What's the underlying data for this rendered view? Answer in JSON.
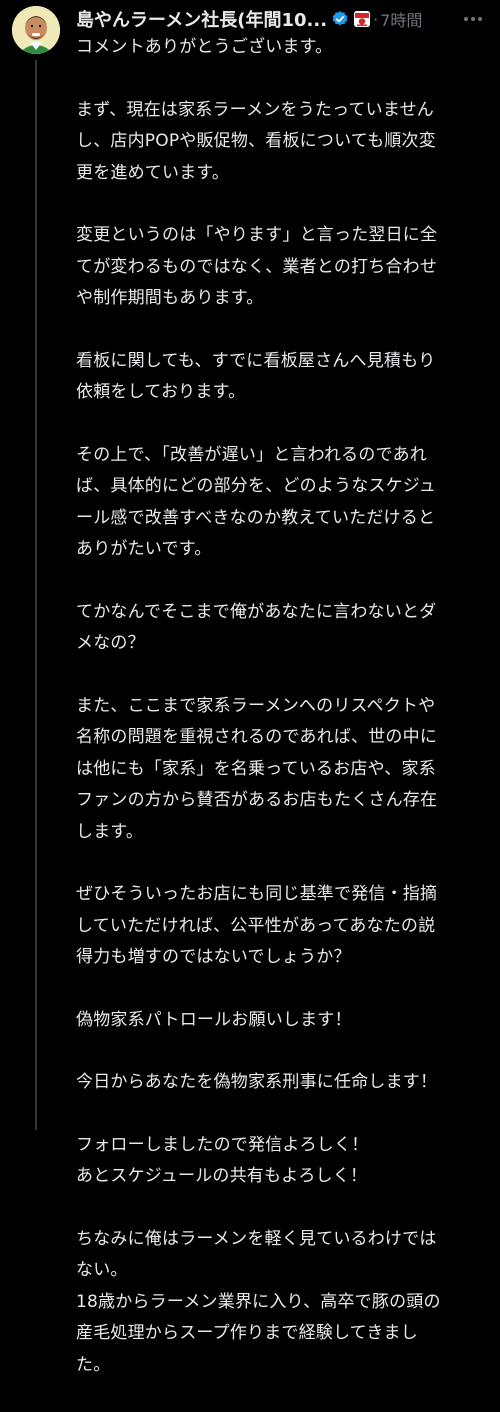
{
  "post": {
    "author_name": "島やんラーメン社長(年間10...",
    "separator": "·",
    "time": "7時間",
    "avatar_icon": "avatar-photo",
    "verified_icon": "verified-badge-icon",
    "affiliate_icon": "affiliate-badge-icon",
    "more_icon": "more-options-icon",
    "colors": {
      "background": "#000000",
      "text": "#e7e9ea",
      "muted": "#71767b",
      "verified": "#1d9bf0",
      "thread_line": "#333639"
    },
    "paragraphs": [
      {
        "lines": [
          "コメントありがとうございます。"
        ]
      },
      {
        "lines": [
          "まず、現在は家系ラーメンをうたっていません",
          "し、店内POPや販促物、看板についても順次変",
          "更を進めています。"
        ]
      },
      {
        "lines": [
          "変更というのは「やります」と言った翌日に全",
          "てが変わるものではなく、業者との打ち合わせ",
          "や制作期間もあります。"
        ]
      },
      {
        "lines": [
          "看板に関しても、すでに看板屋さんへ見積もり",
          "依頼をしております。"
        ]
      },
      {
        "lines": [
          "その上で、「改善が遅い」と言われるのであれ",
          "ば、具体的にどの部分を、どのようなスケジュ",
          "ール感で改善すべきなのか教えていただけると",
          "ありがたいです。"
        ]
      },
      {
        "lines": [
          "てかなんでそこまで俺があなたに言わないとダ",
          "メなの？"
        ]
      },
      {
        "lines": [
          "また、ここまで家系ラーメンへのリスペクトや",
          "名称の問題を重視されるのであれば、世の中に",
          "は他にも「家系」を名乗っているお店や、家系",
          "ファンの方から賛否があるお店もたくさん存在",
          "します。"
        ]
      },
      {
        "lines": [
          "ぜひそういったお店にも同じ基準で発信・指摘",
          "していただければ、公平性があってあなたの説",
          "得力も増すのではないでしょうか？"
        ]
      },
      {
        "lines": [
          "偽物家系パトロールお願いします！"
        ]
      },
      {
        "lines": [
          "今日からあなたを偽物家系刑事に任命します！"
        ]
      },
      {
        "lines": [
          "フォローしましたので発信よろしく！",
          "あとスケジュールの共有もよろしく！"
        ]
      },
      {
        "lines": [
          "ちなみに俺はラーメンを軽く見ているわけでは",
          "ない。",
          "18歳からラーメン業界に入り、高卒で豚の頭の",
          "産毛処理からスープ作りまで経験してきまし",
          "た。"
        ]
      }
    ]
  }
}
